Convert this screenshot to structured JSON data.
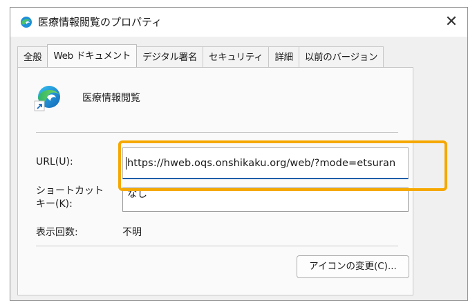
{
  "window": {
    "title": "医療情報閲覧のプロパティ",
    "close_glyph": "✕",
    "title_icon": "edge-icon"
  },
  "tabs": [
    {
      "label": "全般",
      "active": false
    },
    {
      "label": "Web ドキュメント",
      "active": true
    },
    {
      "label": "デジタル署名",
      "active": false
    },
    {
      "label": "セキュリティ",
      "active": false
    },
    {
      "label": "詳細",
      "active": false
    },
    {
      "label": "以前のバージョン",
      "active": false
    }
  ],
  "panel": {
    "app_name": "医療情報閲覧",
    "app_icon": "edge-shortcut-icon",
    "url_label": "URL(U):",
    "url_value": "https://hweb.oqs.onshikaku.org/web/?mode=etsuran",
    "shortcut_label_line1": "ショートカット",
    "shortcut_label_line2": "キー(K):",
    "shortcut_value": "なし",
    "visits_label": "表示回数:",
    "visits_value": "不明",
    "change_icon_button": "アイコンの変更(C)..."
  },
  "colors": {
    "highlight": "#f5a800",
    "focus_underline": "#1f5fa8",
    "edge_blue": "#1f8fd8",
    "edge_green": "#49c46a"
  }
}
